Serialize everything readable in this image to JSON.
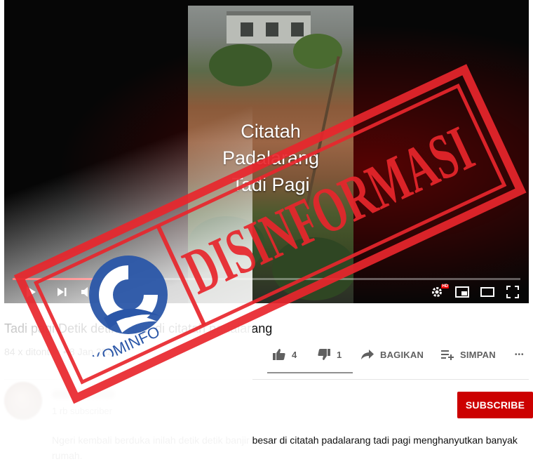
{
  "video": {
    "caption_lines": [
      "Citatah",
      "Padalarang",
      "Tadi Pagi"
    ],
    "progress": 0.22
  },
  "player_controls": {
    "play": "play-icon",
    "next": "next-icon",
    "volume": "volume-icon",
    "settings": "settings-gear-icon",
    "hd_badge": "HD",
    "miniplayer": "miniplayer-icon",
    "theater": "theater-mode-icon",
    "fullscreen": "fullscreen-icon"
  },
  "info": {
    "title": "Tadi pagi Detik detik banjir di citatah padalarang",
    "meta": "84 x ditonton • 8 Jan 2020",
    "likes": "4",
    "dislikes": "1",
    "share_label": "BAGIKAN",
    "save_label": "SIMPAN",
    "more_label": "•••"
  },
  "channel": {
    "subscribers": "1 rb subscriber",
    "subscribe_label": "SUBSCRIBE"
  },
  "description": "Ngeri kembali berduka inilah detik detik banjir besar di citatah padalarang tadi pagi menghanyutkan banyak rumah.",
  "overlay": {
    "stamp_text": "DISINFORMASI",
    "logo_text": "KOMINFO",
    "stamp_color": "#e8262c",
    "logo_blue": "#2a56a8"
  }
}
